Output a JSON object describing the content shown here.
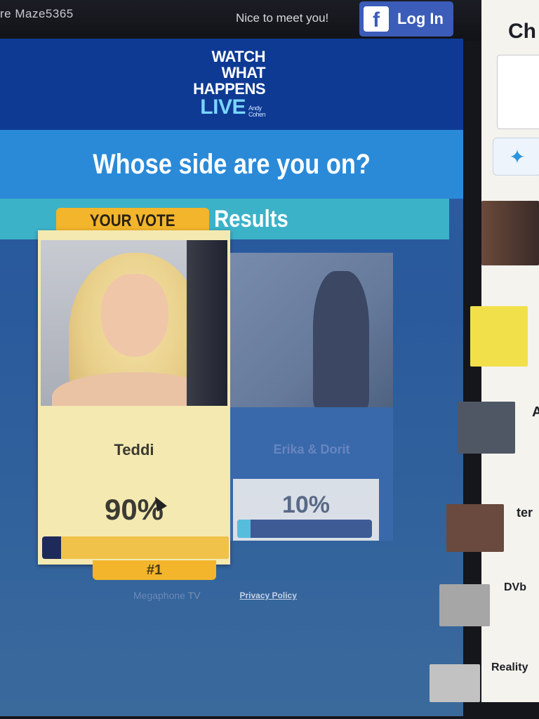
{
  "topbar": {
    "username": "re Maze5365",
    "greeting": "Nice to meet you!",
    "login_label": "Log In",
    "login_icon": "facebook-icon"
  },
  "logo": {
    "line1": "WATCH",
    "line2": "WHAT",
    "line3": "HAPPENS",
    "line4": "LIVE",
    "host_line1": "Andy",
    "host_line2": "Cohen"
  },
  "poll": {
    "question": "Whose side are you on?",
    "status": "Final Results",
    "your_vote_label": "YOUR VOTE",
    "options": [
      {
        "name": "Teddi",
        "percent_label": "90%",
        "percent": 90,
        "rank": "#1"
      },
      {
        "name": "Erika & Dorit",
        "percent_label": "10%",
        "percent": 10
      }
    ]
  },
  "footer": {
    "brand": "Megaphone",
    "brand_suffix": "TV",
    "privacy": "Privacy Policy"
  },
  "sidebar": {
    "title": "Ch",
    "twitter_icon": "twitter-icon",
    "items": [
      {
        "title": "A"
      },
      {
        "title": "ter"
      },
      {
        "title": "DVb"
      },
      {
        "title": "Reality"
      }
    ]
  },
  "colors": {
    "banner": "#0e3a94",
    "question_band": "#2a8ad8",
    "results_band": "#3cb2c8",
    "vote_badge": "#f2b52b",
    "card": "#f4e9b0",
    "facebook": "#3b5cb8"
  }
}
